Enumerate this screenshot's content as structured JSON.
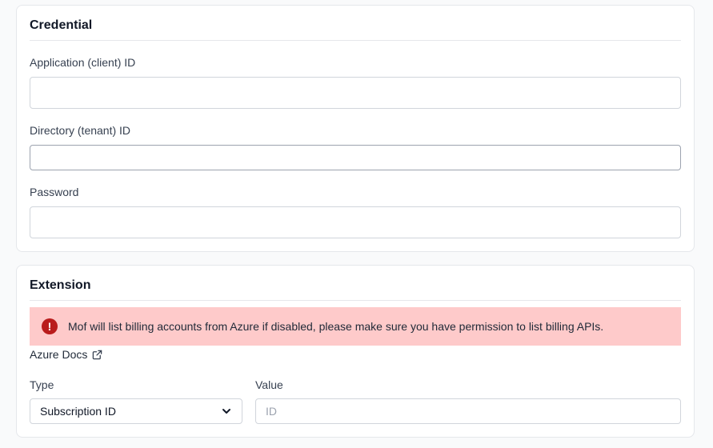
{
  "credential": {
    "title": "Credential",
    "fields": [
      {
        "label": "Application (client) ID",
        "value": "",
        "placeholder": ""
      },
      {
        "label": "Directory (tenant) ID",
        "value": "",
        "placeholder": ""
      },
      {
        "label": "Password",
        "value": "",
        "placeholder": ""
      }
    ]
  },
  "extension": {
    "title": "Extension",
    "alert": {
      "icon": "exclamation-circle-icon",
      "text": "Mof will list billing accounts from Azure if disabled, please make sure you have permission to list billing APIs."
    },
    "docs_link": "Azure Docs",
    "type_label": "Type",
    "type_selected": "Subscription ID",
    "value_label": "Value",
    "value_placeholder": "ID"
  },
  "colors": {
    "alert_bg": "#fecaca",
    "alert_icon": "#b91c1c",
    "border": "#e5e7eb"
  }
}
